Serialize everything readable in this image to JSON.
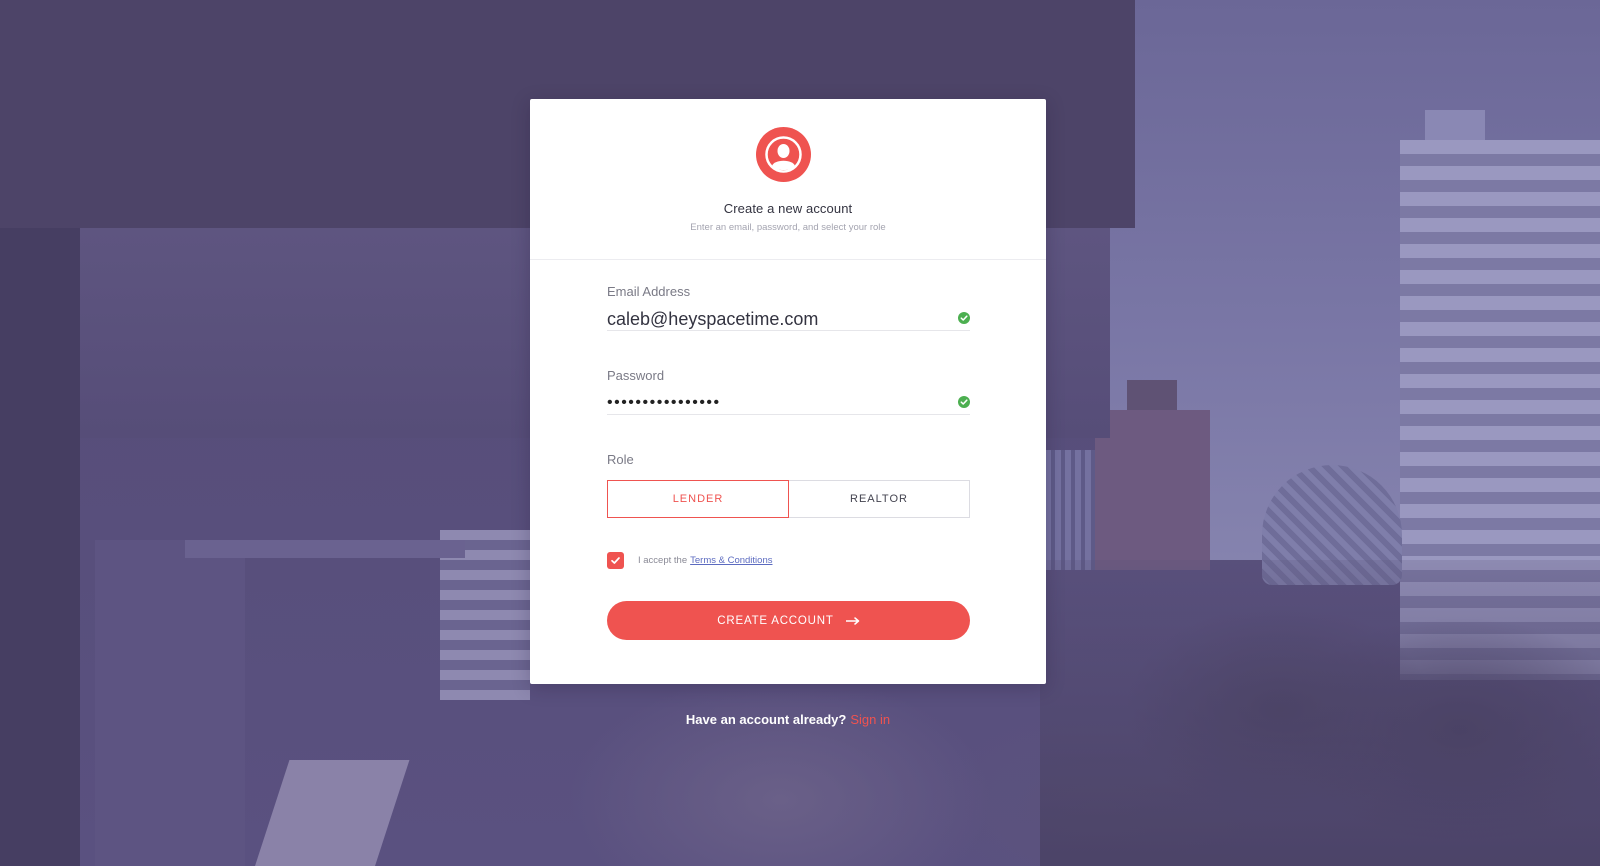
{
  "header": {
    "title": "Create a new account",
    "subtitle": "Enter an email, password, and select your role"
  },
  "form": {
    "email": {
      "label": "Email Address",
      "value": "caleb@heyspacetime.com",
      "valid": true
    },
    "password": {
      "label": "Password",
      "value": "••••••••••••••••",
      "valid": true
    },
    "role": {
      "label": "Role",
      "options": [
        "LENDER",
        "REALTOR"
      ],
      "selected": "LENDER"
    },
    "terms": {
      "checked": true,
      "prefix": "I accept the",
      "link": "Terms & Conditions"
    },
    "submit_label": "CREATE ACCOUNT"
  },
  "footer": {
    "prompt": "Have an account already?",
    "link": "Sign in"
  },
  "colors": {
    "accent": "#ef5350",
    "valid": "#4caf50",
    "link": "#5c6bc0",
    "overlay": "#544b76"
  },
  "icons": {
    "avatar": "user-silhouette-icon",
    "valid": "check-circle-icon",
    "checkbox": "checkmark-icon",
    "submit": "arrow-right-icon"
  }
}
